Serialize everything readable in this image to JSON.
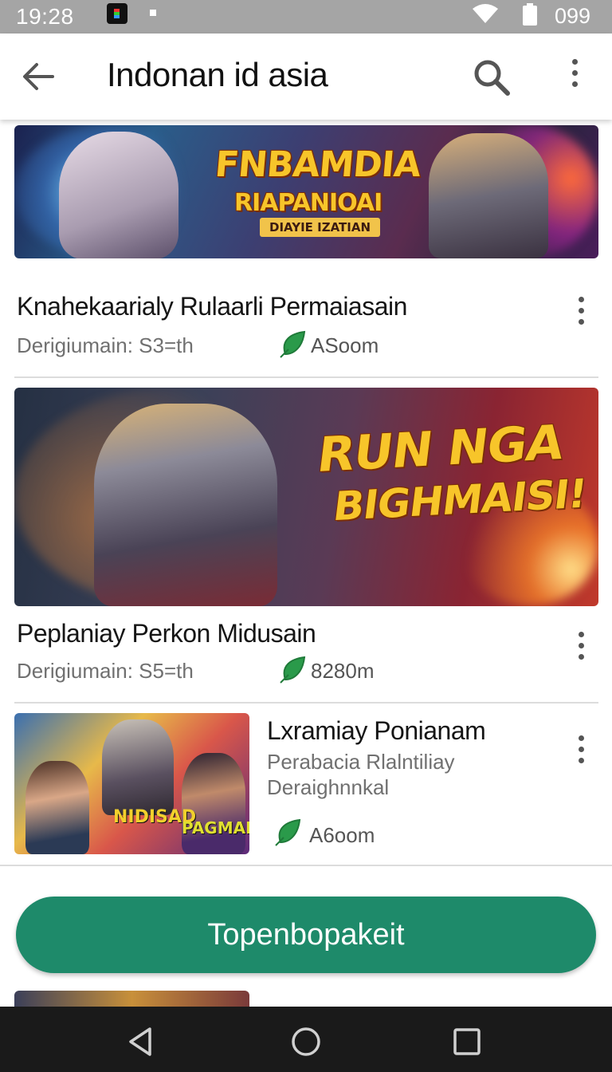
{
  "status_bar": {
    "time": "19:28",
    "battery": "099",
    "icons": [
      "app-icon",
      "notification-dot",
      "wifi-icon",
      "battery-icon"
    ]
  },
  "app_bar": {
    "title": "Indonan id asia",
    "icons": [
      "back-arrow-icon",
      "search-icon",
      "more-vert-icon"
    ]
  },
  "items": [
    {
      "banner_text": [
        "FNBAMDIA",
        "RIAPANIOAI",
        "DIAYIE IZATIAN"
      ],
      "title": "Knahekaarialy Rulaarli Permaiasain",
      "meta": "Derigiumain: S3=th",
      "stat": "ASoom"
    },
    {
      "banner_text": [
        "RUN NGA",
        "BIGHMAISI!"
      ],
      "title": "Peplaniay Perkon Midusain",
      "meta": "Derigiumain: S5=th",
      "stat": "8280m"
    },
    {
      "thumb_text": [
        "NIDISAD",
        "PAGMAIA"
      ],
      "title": "Lxramiay Ponianam",
      "subtitle_1": "Perabacia Rlalntiliay",
      "subtitle_2": "Deraighnnkal",
      "stat": "A6oom"
    }
  ],
  "cta": {
    "label": "Topenbopakeit"
  },
  "colors": {
    "accent": "#1e8a6a",
    "leaf": "#2a9a4a",
    "status_bar": "#a5a5a5"
  }
}
